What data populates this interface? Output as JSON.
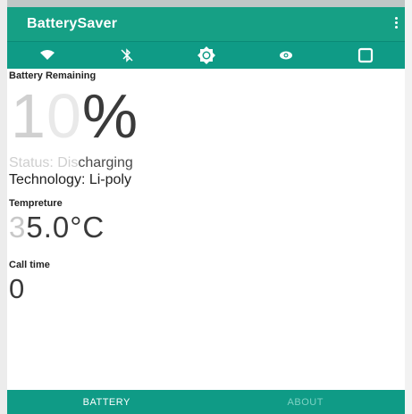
{
  "app": {
    "title": "BatterySaver"
  },
  "toolbar": {
    "icons": [
      "wifi-icon",
      "bluetooth-icon",
      "brightness-icon",
      "location-icon",
      "screen-icon"
    ]
  },
  "battery": {
    "remaining_label": "Battery Remaining",
    "percent_digit1": "1",
    "percent_digit2": "0",
    "percent_sign": "%",
    "status_prefix": "Status",
    "status_dim": ": Dis",
    "status_value": "charging",
    "technology": "Technology: Li-poly"
  },
  "temperature": {
    "label": "Tempreture",
    "value_dim": "3",
    "value": "5.0°C"
  },
  "call_time": {
    "label": "Call time",
    "value": "0"
  },
  "tabs": [
    {
      "label": "BATTERY",
      "active": true
    },
    {
      "label": "ABOUT",
      "active": false
    }
  ],
  "colors": {
    "primary": "#16a085",
    "primary_dark": "#0f9b86",
    "tab_inactive": "#7ed2c4"
  }
}
